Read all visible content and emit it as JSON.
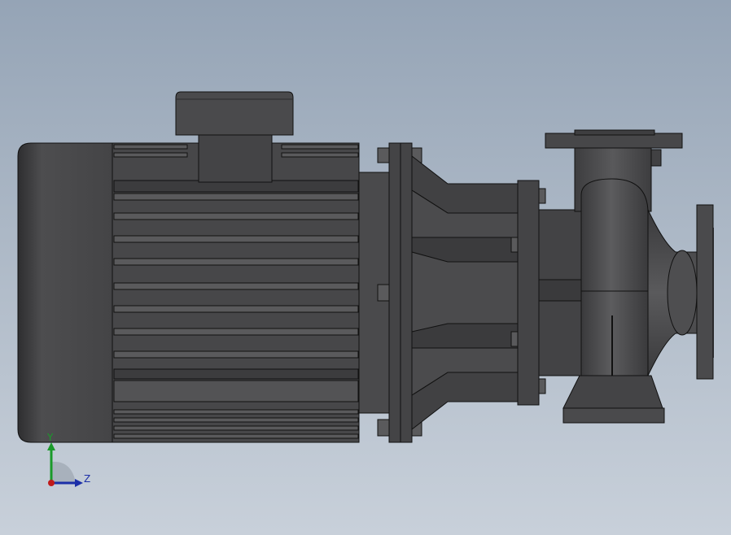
{
  "model": {
    "part": "centrifugal-pump-assembly",
    "colors": {
      "background_top": "#95a4b6",
      "background_bottom": "#c8d0da",
      "body_dark": "#3f3f41",
      "body_mid": "#4b4b4d",
      "body_light": "#5a5a5c",
      "edge": "#111111"
    }
  },
  "triad": {
    "y_label": "Y",
    "z_label": "Z",
    "colors": {
      "y": "#1a9a2a",
      "z": "#1c2fa8",
      "x": "#c01a1a"
    }
  }
}
